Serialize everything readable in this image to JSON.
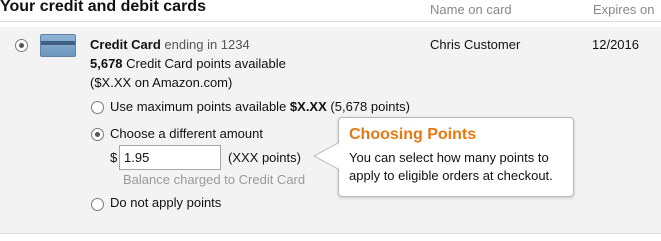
{
  "header": {
    "title": "Your credit and debit cards",
    "col_name": "Name on card",
    "col_expires": "Expires on"
  },
  "card": {
    "name": "Credit Card",
    "ending": "ending in 1234",
    "points_count": "5,678",
    "points_label": "Credit Card points available",
    "points_value": "($X.XX on Amazon.com)",
    "holder": "Chris Customer",
    "expires": "12/2016",
    "selected": true
  },
  "points_options": {
    "max": {
      "label": "Use maximum points available",
      "amount": "$X.XX",
      "points": "(5,678 points)",
      "selected": false
    },
    "custom": {
      "label": "Choose a different amount",
      "currency": "$",
      "value": "1.95",
      "points": "(XXX points)",
      "balance_note": "Balance charged to Credit Card",
      "selected": true
    },
    "none": {
      "label": "Do not apply points",
      "selected": false
    }
  },
  "callout": {
    "title": "Choosing Points",
    "line1": "You can select how many points to",
    "line2": "apply to eligible orders at checkout."
  },
  "colors": {
    "accent": "#e47911",
    "row_background": "#f3f3f3"
  }
}
